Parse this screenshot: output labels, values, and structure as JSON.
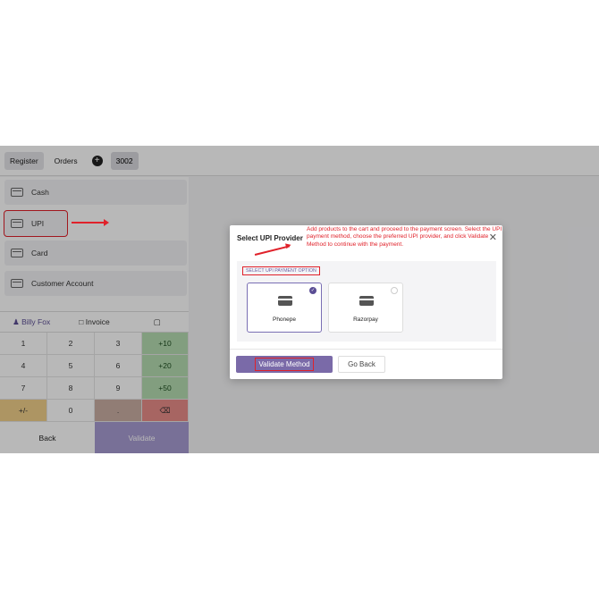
{
  "topbar": {
    "register": "Register",
    "orders": "Orders",
    "plus": "+",
    "order_number": "3002"
  },
  "payment_methods": [
    "Cash",
    "UPI",
    "Card",
    "Customer Account"
  ],
  "customer": {
    "name": "Billy Fox",
    "invoice": "Invoice"
  },
  "keypad": [
    "1",
    "2",
    "3",
    "+10",
    "4",
    "5",
    "6",
    "+20",
    "7",
    "8",
    "9",
    "+50",
    "+/-",
    "0",
    ".",
    "⌫"
  ],
  "bottom": {
    "back": "Back",
    "validate": "Validate"
  },
  "modal": {
    "title": "Select UPI Provider",
    "note": "Add products to the cart and proceed to the payment screen. Select the UPI payment method, choose the preferred UPI provider, and click Validate Method to continue with the payment.",
    "section_label": "SELECT UPI PAYMENT OPTION",
    "providers": [
      {
        "name": "Phonepe",
        "selected": true
      },
      {
        "name": "Razorpay",
        "selected": false
      }
    ],
    "validate_button": "Validate Method",
    "go_back_button": "Go Back"
  },
  "colors": {
    "accent": "#7a6aa8",
    "annotation": "#e0212a"
  }
}
